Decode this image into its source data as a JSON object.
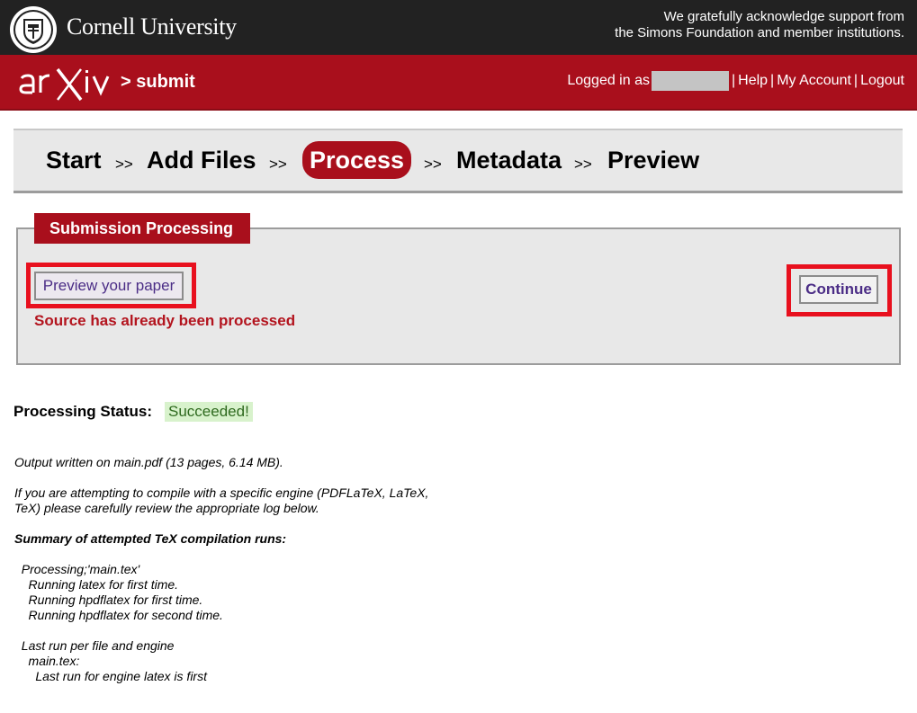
{
  "header": {
    "org_name": "Cornell University",
    "support_line1": "We gratefully acknowledge support from",
    "support_line2": "the Simons Foundation and member institutions.",
    "seal_icon": "cornell-seal-icon"
  },
  "arxiv_bar": {
    "logo_text": "arXiv",
    "crumb": "> submit",
    "logged_in_prefix": "Logged in as",
    "links": [
      "Help",
      "My Account",
      "Logout"
    ],
    "separator": "|"
  },
  "steps": {
    "items": [
      "Start",
      "Add Files",
      "Process",
      "Metadata",
      "Preview"
    ],
    "active": "Process",
    "arrow": ">>"
  },
  "processing": {
    "tab_title": "Submission Processing",
    "preview_button": "Preview your paper",
    "continue_button": "Continue",
    "message": "Source has already been processed"
  },
  "status": {
    "label": "Processing Status:",
    "value": "Succeeded!"
  },
  "log": {
    "output": "Output written on main.pdf (13 pages, 6.14 MB).",
    "engine_note": "If you are attempting to compile with a specific engine (PDFLaTeX, LaTeX,\nTeX) please carefully review the appropriate log below.",
    "summary_heading": "Summary of attempted TeX compilation runs:",
    "runs": "  Processing;'main.tex'\n    Running latex for first time.\n    Running hpdflatex for first time.\n    Running hpdflatex for second time.",
    "last_run": "  Last run per file and engine\n    main.tex:\n      Last run for engine latex is first"
  },
  "colors": {
    "arxiv_red": "#a90f1c",
    "highlight_red": "#e8101e",
    "link_purple": "#4b2d86",
    "success_bg": "#d8f2cc"
  }
}
